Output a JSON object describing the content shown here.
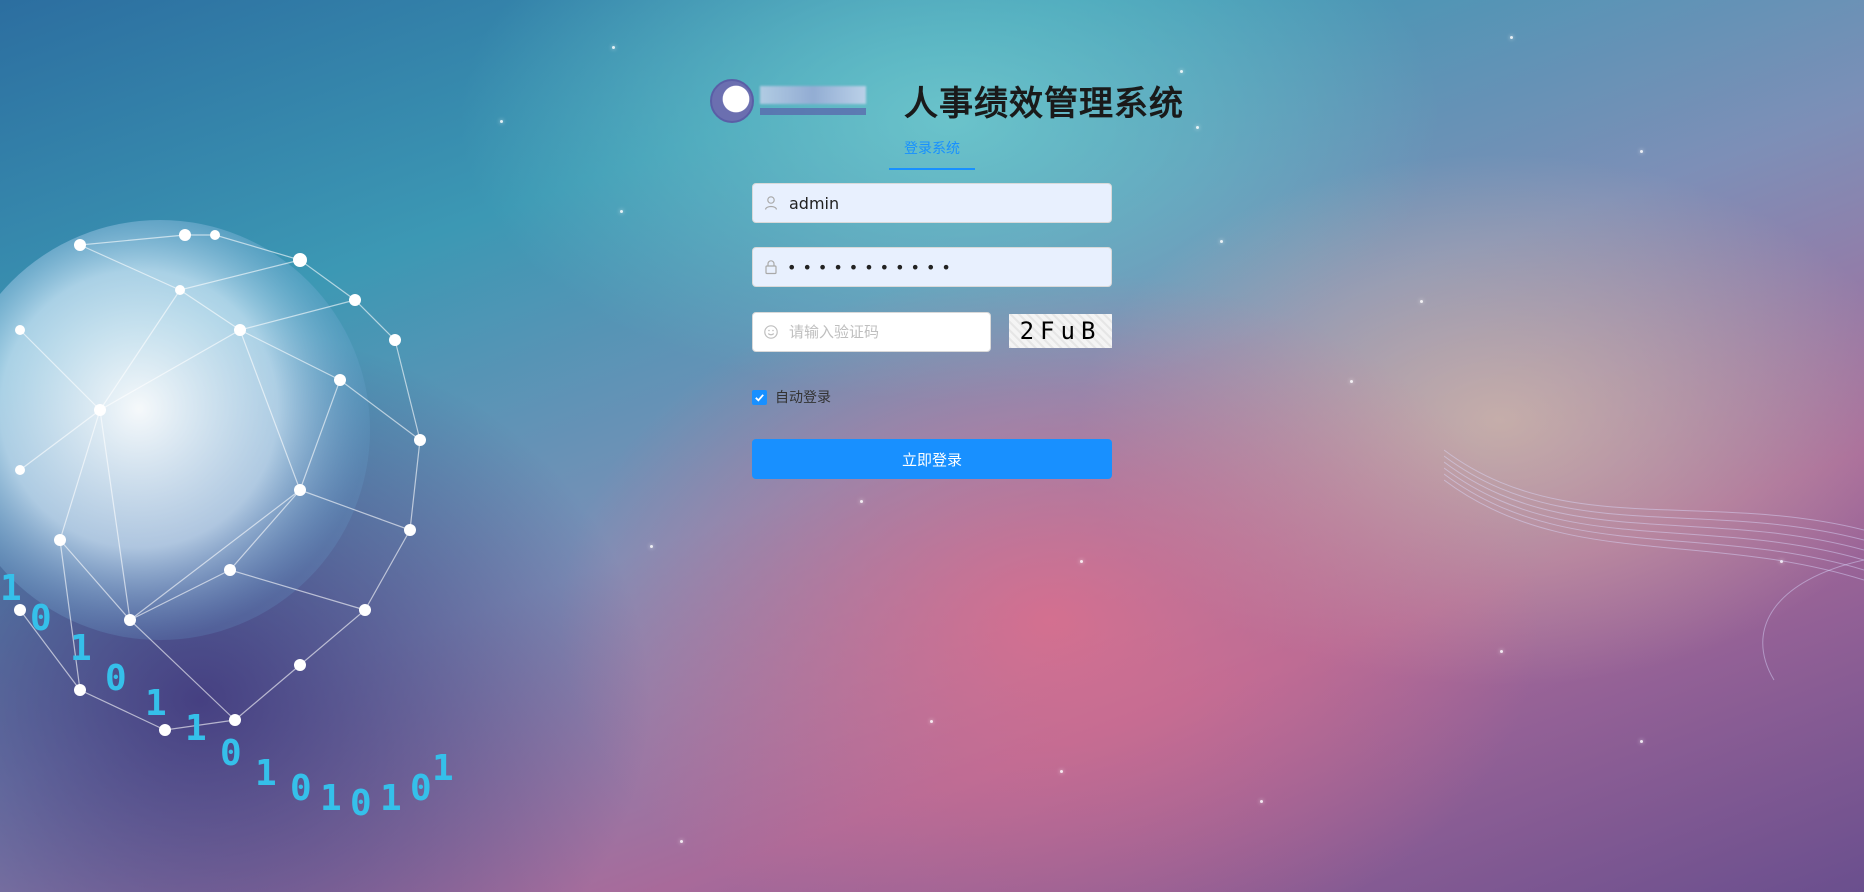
{
  "header": {
    "title": "人事绩效管理系统",
    "logo": "school-logo-blurred"
  },
  "tabs": [
    {
      "label": "登录系统",
      "active": true
    }
  ],
  "form": {
    "username": {
      "value": "admin",
      "icon": "user-icon"
    },
    "password": {
      "masked": "•••••••••••",
      "icon": "lock-icon"
    },
    "captcha": {
      "placeholder": "请输入验证码",
      "icon": "captcha-icon",
      "image_text": "2FuB"
    },
    "remember": {
      "label": "自动登录",
      "checked": true
    },
    "submit_label": "立即登录"
  },
  "colors": {
    "primary": "#1890ff",
    "input_bg": "#e8f0fe"
  }
}
